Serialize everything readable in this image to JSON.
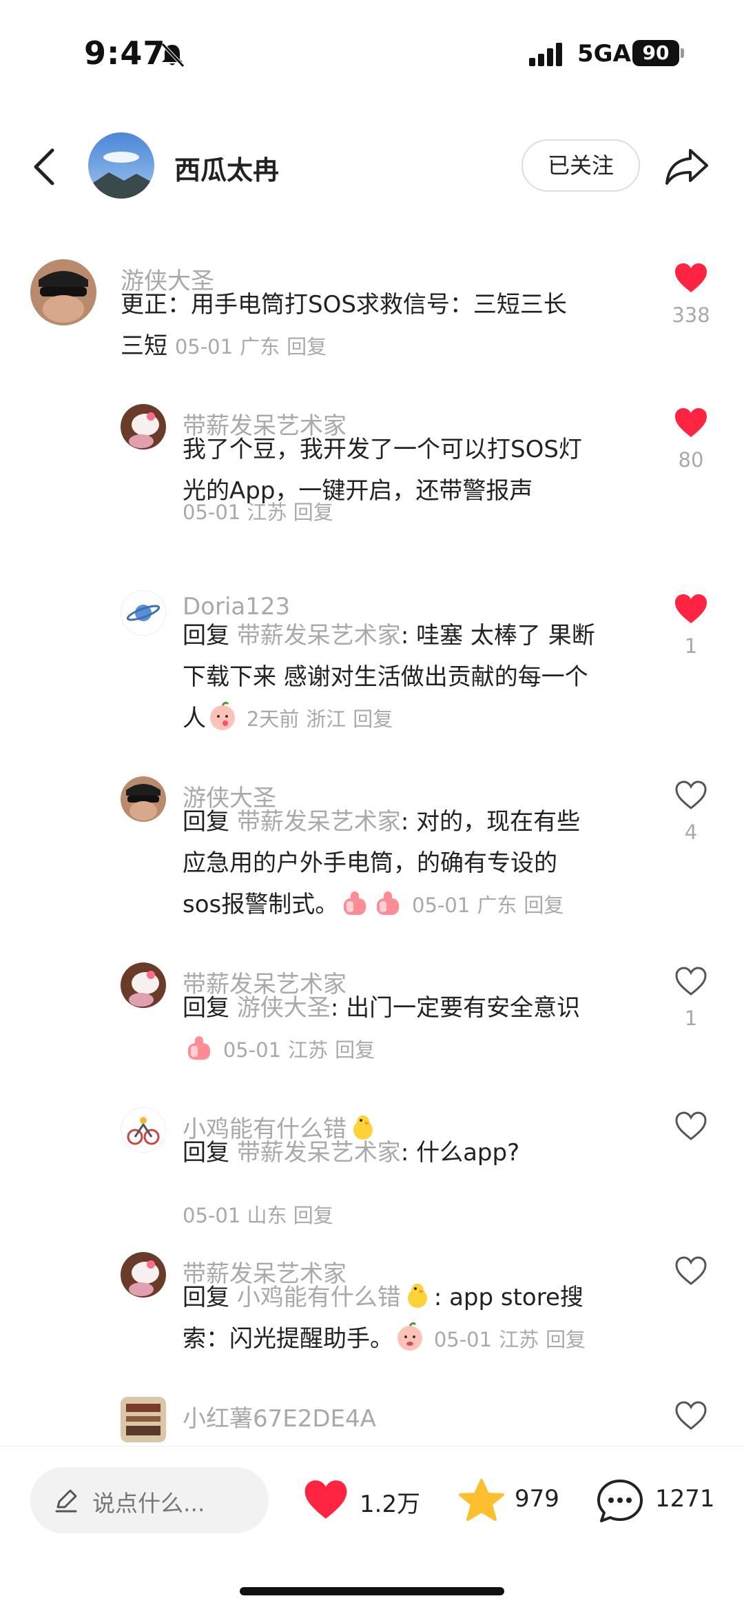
{
  "status_bar": {
    "time": "9:47",
    "network": "5GA",
    "battery": "90"
  },
  "header": {
    "name": "西瓜太冉",
    "follow_label": "已关注"
  },
  "comments": [
    {
      "name": "游侠大圣",
      "body": "更正：用手电筒打SOS求救信号：三短三长",
      "body2": "三短",
      "date": "05-01",
      "location": "广东",
      "reply": "回复",
      "likes": "338",
      "liked": true
    },
    {
      "name": "带薪发呆艺术家",
      "body": "我了个豆，我开发了一个可以打SOS灯",
      "body2": "光的App，一键开启，还带警报声",
      "date": "05-01",
      "location": "江苏",
      "reply": "回复",
      "likes": "80",
      "liked": true
    },
    {
      "name": "Doria123",
      "reply_word": "回复",
      "reply_target": "带薪发呆艺术家",
      "body": ": 哇塞 太棒了 果断",
      "body2": "下载下来 感谢对生活做出贡献的每一个",
      "body3": "人",
      "date": "2天前",
      "location": "浙江",
      "reply": "回复",
      "likes": "1",
      "liked": true
    },
    {
      "name": "游侠大圣",
      "reply_word": "回复",
      "reply_target": "带薪发呆艺术家",
      "body": ": 对的，现在有些",
      "body2": "应急用的户外手电筒，的确有专设的",
      "body3": "sos报警制式。",
      "date": "05-01",
      "location": "广东",
      "reply": "回复",
      "likes": "4",
      "liked": false
    },
    {
      "name": "带薪发呆艺术家",
      "reply_word": "回复",
      "reply_target": "游侠大圣",
      "body": ": 出门一定要有安全意识",
      "date": "05-01",
      "location": "江苏",
      "reply": "回复",
      "likes": "1",
      "liked": false
    },
    {
      "name": "小鸡能有什么错",
      "reply_word": "回复",
      "reply_target": "带薪发呆艺术家",
      "body": ": 什么app?",
      "date": "05-01",
      "location": "山东",
      "reply": "回复",
      "likes": "",
      "liked": false
    },
    {
      "name": "带薪发呆艺术家",
      "reply_word": "回复",
      "reply_target": "小鸡能有什么错",
      "body": ": app store搜",
      "body2": "索：闪光提醒助手。",
      "date": "05-01",
      "location": "江苏",
      "reply": "回复",
      "likes": "",
      "liked": false
    },
    {
      "name": "小红薯67E2DE4A",
      "likes": "",
      "liked": false
    }
  ],
  "bottom_bar": {
    "placeholder": "说点什么...",
    "likes": "1.2万",
    "favorites": "979",
    "comments": "1271"
  },
  "colors": {
    "like_red": "#ff2442",
    "star_yellow": "#fdbe2f",
    "muted_gray": "#a9a9a9"
  },
  "icons": [
    "back-icon",
    "share-icon",
    "heart-icon",
    "star-icon",
    "chat-icon",
    "pencil-icon",
    "bell-off-icon"
  ]
}
